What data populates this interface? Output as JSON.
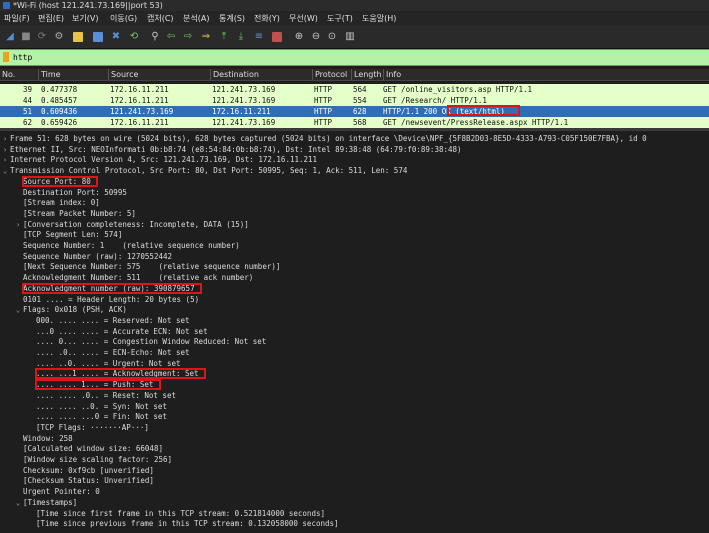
{
  "title": "*Wi-Fi (host 121.241.73.169||port 53)",
  "menu": [
    "파일(F)",
    "편집(E)",
    "보기(V)",
    "이동(G)",
    "캡처(C)",
    "분석(A)",
    "통계(S)",
    "전화(Y)",
    "무선(W)",
    "도구(T)",
    "도움말(H)"
  ],
  "toolbar_icons": [
    "shark-fin-start-icon",
    "stop-square-icon",
    "restart-icon",
    "options-gear-icon",
    "open-folder-icon",
    "save-file-icon",
    "close-file-icon",
    "reload-icon",
    "search-icon",
    "go-back-arrow-icon",
    "go-forward-arrow-icon",
    "go-to-packet-icon",
    "first-packet-icon",
    "last-packet-icon",
    "autoscroll-icon",
    "colorize-icon",
    "zoom-in-icon",
    "zoom-out-icon",
    "normal-size-icon",
    "resize-columns-icon"
  ],
  "filter": {
    "value": "http"
  },
  "columns": [
    "No.",
    "Time",
    "Source",
    "Destination",
    "Protocol",
    "Length",
    "Info"
  ],
  "packets": [
    {
      "no": "39",
      "time": "0.477378",
      "src": "172.16.11.211",
      "dst": "121.241.73.169",
      "proto": "HTTP",
      "len": "564",
      "info": "GET /online_visitors.asp HTTP/1.1",
      "style": "http"
    },
    {
      "no": "44",
      "time": "0.485457",
      "src": "172.16.11.211",
      "dst": "121.241.73.169",
      "proto": "HTTP",
      "len": "554",
      "info": "GET /Research/ HTTP/1.1",
      "style": "http"
    },
    {
      "no": "51",
      "time": "0.609436",
      "src": "121.241.73.169",
      "dst": "172.16.11.211",
      "proto": "HTTP",
      "len": "628",
      "info": "HTTP/1.1 200 OK  (text/html)",
      "style": "sel"
    },
    {
      "no": "62",
      "time": "0.659426",
      "src": "172.16.11.211",
      "dst": "121.241.73.169",
      "proto": "HTTP",
      "len": "568",
      "info": "GET /newsevent/PressRelease.aspx HTTP/1.1",
      "style": "http"
    }
  ],
  "details": [
    {
      "tw": "›",
      "text": "Frame 51: 628 bytes on wire (5024 bits), 628 bytes captured (5024 bits) on interface \\Device\\NPF_{5F8B2D03-8E5D-4333-A793-C05F150E7FBA}, id 0"
    },
    {
      "tw": "›",
      "text": "Ethernet II, Src: NEOInformati 0b:b8:74 (e8:54:84:0b:b8:74), Dst: Intel 89:38:48 (64:79:f0:89:38:48)"
    },
    {
      "tw": "›",
      "text": "Internet Protocol Version 4, Src: 121.241.73.169, Dst: 172.16.11.211"
    },
    {
      "tw": "⌄",
      "text": "Transmission Control Protocol, Src Port: 80, Dst Port: 50995, Seq: 1, Ack: 511, Len: 574"
    },
    {
      "tw": "",
      "text": "Source Port: 80",
      "indent": 1,
      "hl": true
    },
    {
      "tw": "",
      "text": "Destination Port: 50995",
      "indent": 1
    },
    {
      "tw": "",
      "text": "[Stream index: 0]",
      "indent": 1
    },
    {
      "tw": "",
      "text": "[Stream Packet Number: 5]",
      "indent": 1
    },
    {
      "tw": "›",
      "text": "[Conversation completeness: Incomplete, DATA (15)]",
      "indent": 1
    },
    {
      "tw": "",
      "text": "[TCP Segment Len: 574]",
      "indent": 1
    },
    {
      "tw": "",
      "text": "Sequence Number: 1    (relative sequence number)",
      "indent": 1
    },
    {
      "tw": "",
      "text": "Sequence Number (raw): 1270552442",
      "indent": 1
    },
    {
      "tw": "",
      "text": "[Next Sequence Number: 575    (relative sequence number)]",
      "indent": 1
    },
    {
      "tw": "",
      "text": "Acknowledgment Number: 511    (relative ack number)",
      "indent": 1
    },
    {
      "tw": "",
      "text": "Acknowledgment number (raw): 390879657",
      "indent": 1,
      "hl": true
    },
    {
      "tw": "",
      "text": "0101 .... = Header Length: 20 bytes (5)",
      "indent": 1
    },
    {
      "tw": "⌄",
      "text": "Flags: 0x018 (PSH, ACK)",
      "indent": 1
    },
    {
      "tw": "",
      "text": "000. .... .... = Reserved: Not set",
      "indent": 2
    },
    {
      "tw": "",
      "text": "...0 .... .... = Accurate ECN: Not set",
      "indent": 2
    },
    {
      "tw": "",
      "text": ".... 0... .... = Congestion Window Reduced: Not set",
      "indent": 2
    },
    {
      "tw": "",
      "text": ".... .0.. .... = ECN-Echo: Not set",
      "indent": 2
    },
    {
      "tw": "",
      "text": ".... ..0. .... = Urgent: Not set",
      "indent": 2
    },
    {
      "tw": "",
      "text": ".... ...1 .... = Acknowledgment: Set",
      "indent": 2,
      "hl": true
    },
    {
      "tw": "",
      "text": ".... .... 1... = Push: Set",
      "indent": 2,
      "hl": true
    },
    {
      "tw": "",
      "text": ".... .... .0.. = Reset: Not set",
      "indent": 2
    },
    {
      "tw": "",
      "text": ".... .... ..0. = Syn: Not set",
      "indent": 2
    },
    {
      "tw": "",
      "text": ".... .... ...0 = Fin: Not set",
      "indent": 2
    },
    {
      "tw": "",
      "text": "[TCP Flags: ·······AP···]",
      "indent": 2
    },
    {
      "tw": "",
      "text": "Window: 258",
      "indent": 1
    },
    {
      "tw": "",
      "text": "[Calculated window size: 66048]",
      "indent": 1
    },
    {
      "tw": "",
      "text": "[Window size scaling factor: 256]",
      "indent": 1
    },
    {
      "tw": "",
      "text": "Checksum: 0xf9cb [unverified]",
      "indent": 1
    },
    {
      "tw": "",
      "text": "[Checksum Status: Unverified]",
      "indent": 1
    },
    {
      "tw": "",
      "text": "Urgent Pointer: 0",
      "indent": 1
    },
    {
      "tw": "⌄",
      "text": "[Timestamps]",
      "indent": 1
    },
    {
      "tw": "",
      "text": "[Time since first frame in this TCP stream: 0.521814000 seconds]",
      "indent": 2
    },
    {
      "tw": "",
      "text": "[Time since previous frame in this TCP stream: 0.132058000 seconds]",
      "indent": 2
    }
  ]
}
